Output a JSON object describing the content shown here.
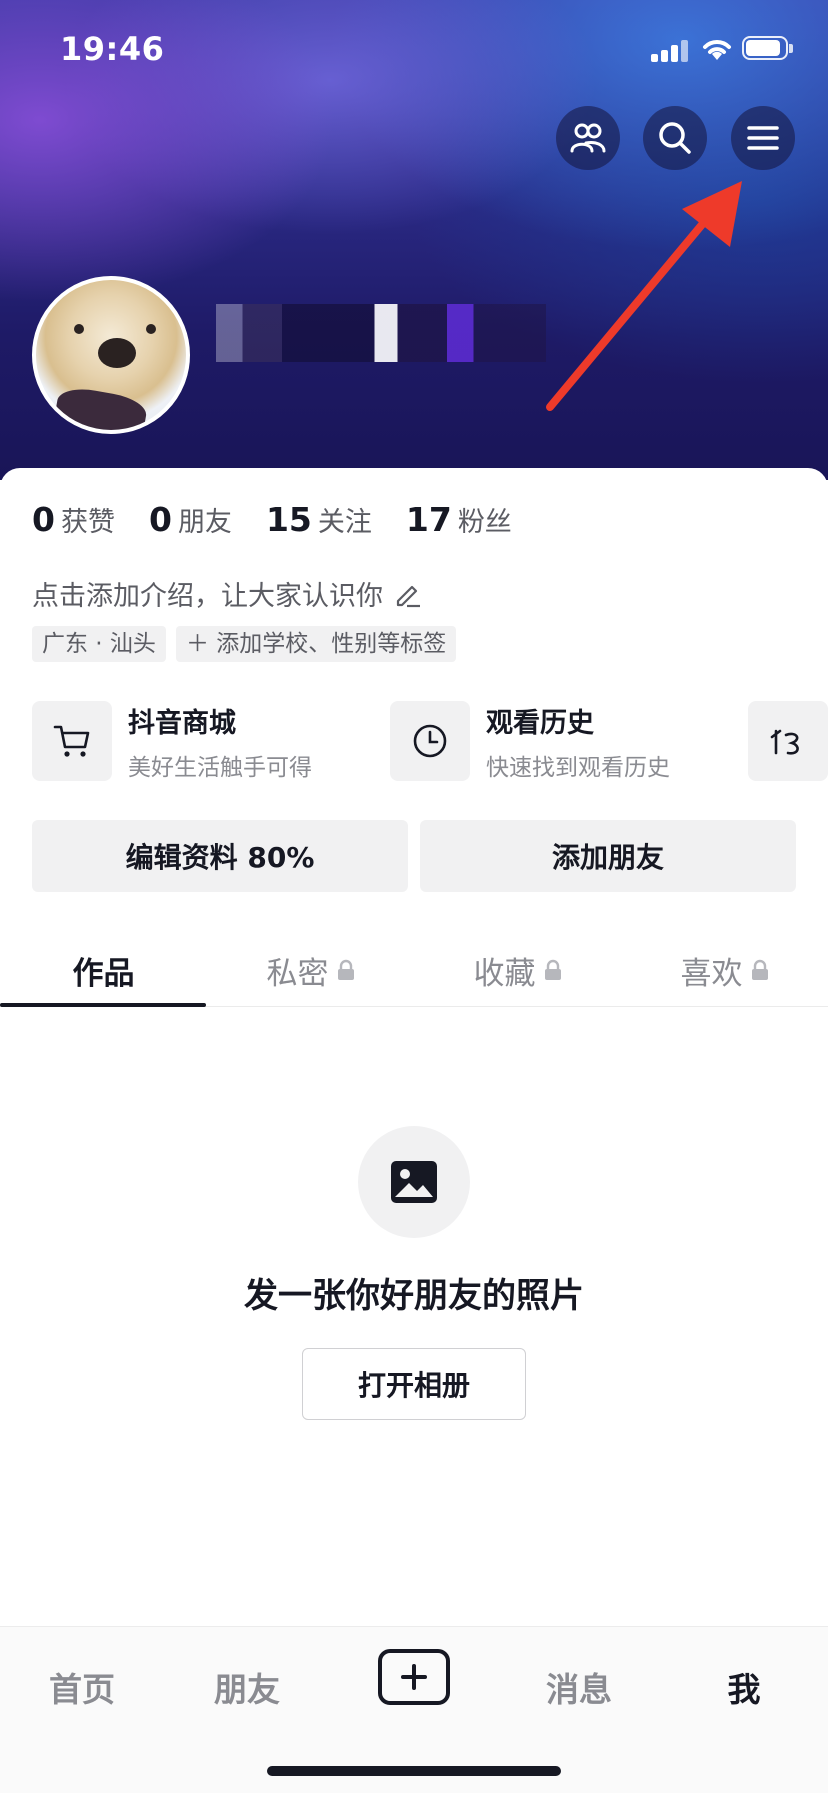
{
  "status_bar": {
    "time": "19:46"
  },
  "stats": [
    {
      "value": "0",
      "label": "获赞"
    },
    {
      "value": "0",
      "label": "朋友"
    },
    {
      "value": "15",
      "label": "关注"
    },
    {
      "value": "17",
      "label": "粉丝"
    }
  ],
  "bio": "点击添加介绍，让大家认识你",
  "tags": {
    "location": "广东 · 汕头",
    "add_tags": "添加学校、性别等标签"
  },
  "quick_links": [
    {
      "title": "抖音商城",
      "subtitle": "美好生活触手可得",
      "icon": "cart-icon"
    },
    {
      "title": "观看历史",
      "subtitle": "快速找到观看历史",
      "icon": "clock-icon"
    }
  ],
  "buttons": {
    "edit_profile": "编辑资料 80%",
    "add_friends": "添加朋友"
  },
  "tabs": [
    {
      "label": "作品",
      "locked": false,
      "active": true
    },
    {
      "label": "私密",
      "locked": true,
      "active": false
    },
    {
      "label": "收藏",
      "locked": true,
      "active": false
    },
    {
      "label": "喜欢",
      "locked": true,
      "active": false
    }
  ],
  "empty_state": {
    "title": "发一张你好朋友的照片",
    "button": "打开相册"
  },
  "bottom_nav": [
    {
      "label": "首页",
      "active": false
    },
    {
      "label": "朋友",
      "active": false
    },
    {
      "label": "",
      "icon": "plus-icon"
    },
    {
      "label": "消息",
      "active": false
    },
    {
      "label": "我",
      "active": true
    }
  ],
  "colors": {
    "accent_arrow": "#ee3a2a",
    "text_primary": "#161823",
    "text_secondary": "#5b5c63"
  }
}
